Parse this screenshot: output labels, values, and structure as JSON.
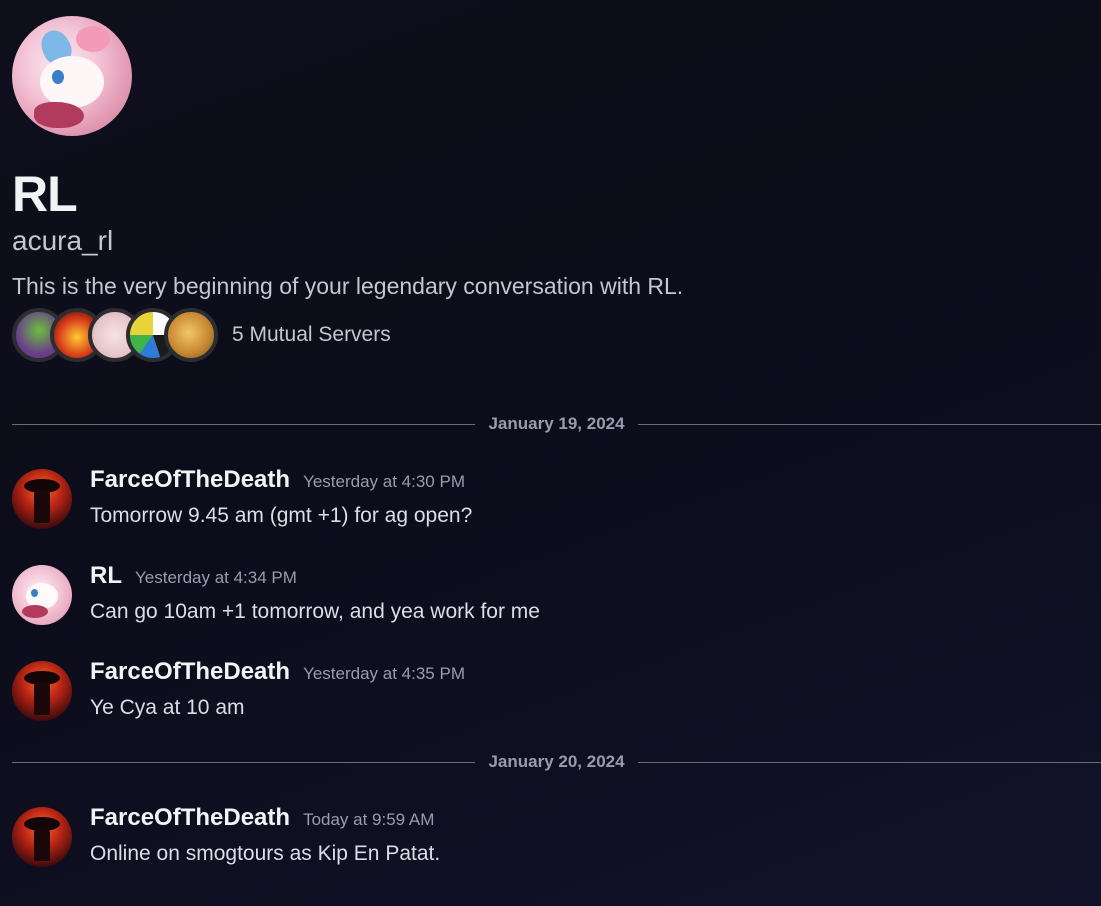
{
  "profile": {
    "display_name": "RL",
    "username": "acura_rl",
    "intro": "This is the very beginning of your legendary conversation with RL.",
    "mutual_servers_label": "5 Mutual Servers"
  },
  "dividers": [
    {
      "date": "January 19, 2024"
    },
    {
      "date": "January 20, 2024"
    }
  ],
  "messages": [
    {
      "author": "FarceOfTheDeath",
      "timestamp": "Yesterday at 4:30 PM",
      "text": "Tomorrow 9.45 am (gmt +1) for ag open?"
    },
    {
      "author": "RL",
      "timestamp": "Yesterday at 4:34 PM",
      "text": "Can go 10am +1 tomorrow, and yea work for me"
    },
    {
      "author": "FarceOfTheDeath",
      "timestamp": "Yesterday at 4:35 PM",
      "text": "Ye Cya at 10 am"
    },
    {
      "author": "FarceOfTheDeath",
      "timestamp": "Today at 9:59 AM",
      "text": "Online on smogtours as Kip En Patat."
    }
  ]
}
